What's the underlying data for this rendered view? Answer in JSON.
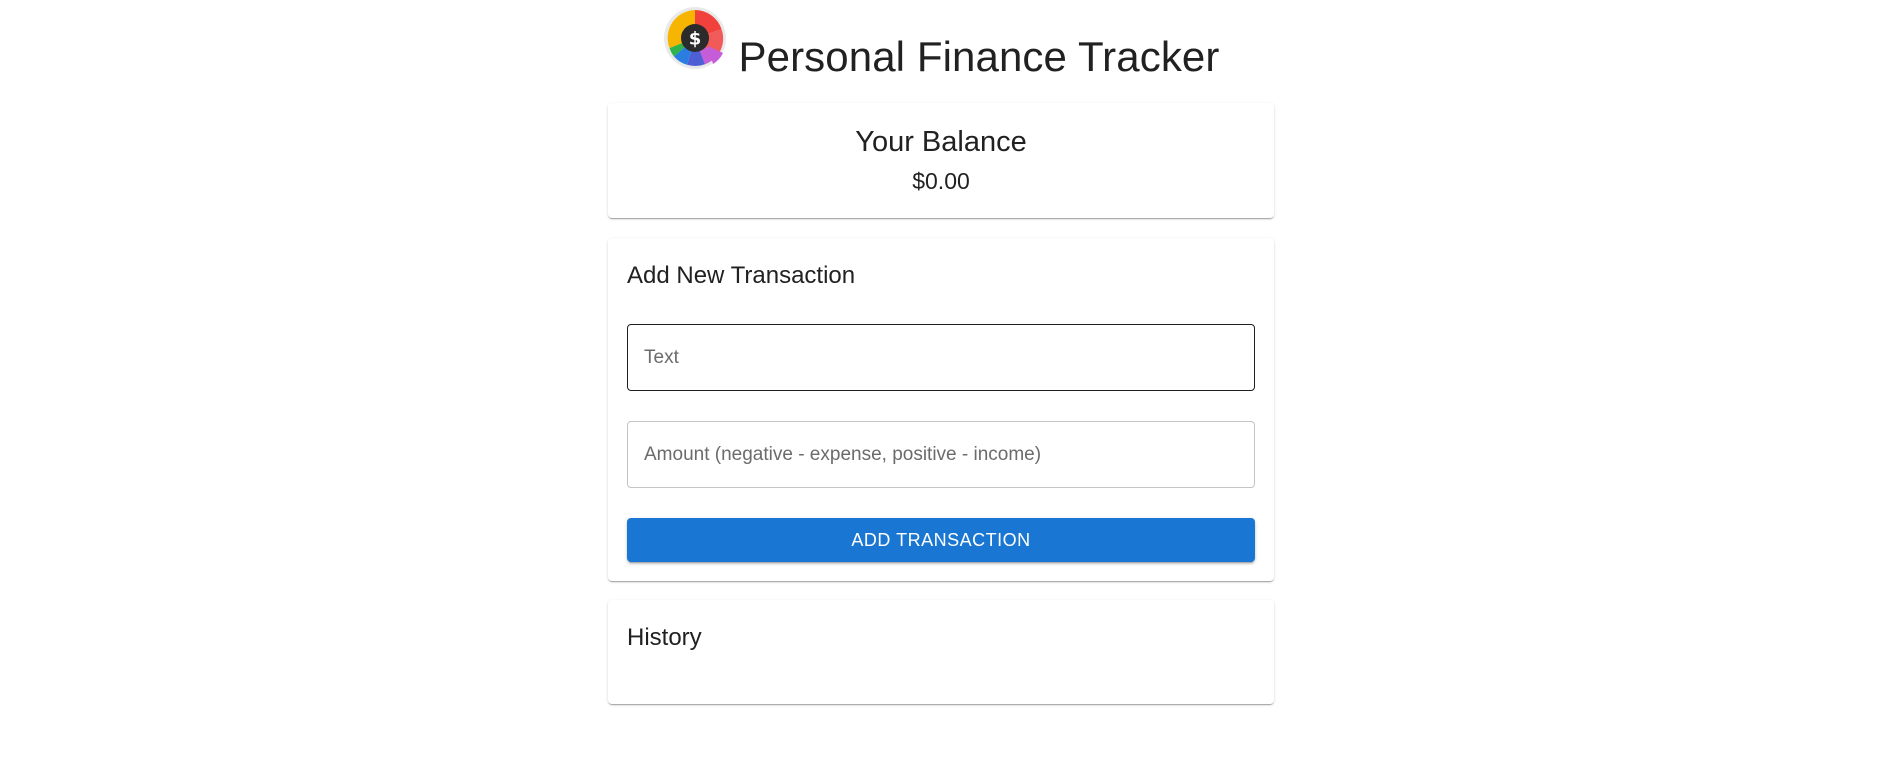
{
  "header": {
    "title": "Personal Finance Tracker",
    "logo_icon": "finance-logo-icon",
    "logo_symbol": "$"
  },
  "balance": {
    "title": "Your Balance",
    "value": "$0.00"
  },
  "add_transaction": {
    "title": "Add New Transaction",
    "text_placeholder": "Text",
    "text_value": "",
    "amount_placeholder": "Amount (negative - expense, positive - income)",
    "amount_value": "",
    "button_label": "ADD TRANSACTION"
  },
  "history": {
    "title": "History",
    "items": []
  },
  "colors": {
    "primary": "#1976d2",
    "text": "#212121",
    "placeholder": "#6b6b6b",
    "logo_red": "#f0413c",
    "logo_yellow": "#f6b500",
    "logo_green": "#2fb34a",
    "logo_blue": "#2a7de1",
    "logo_purple": "#c55cd8"
  }
}
